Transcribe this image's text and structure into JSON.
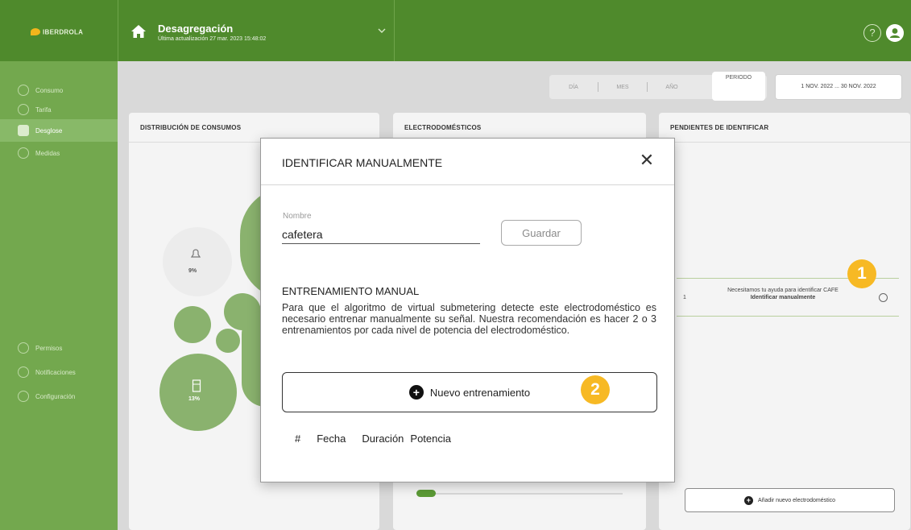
{
  "header": {
    "logo_text": "IBERDROLA",
    "title": "Desagregación",
    "subtitle": "Última actualización 27 mar. 2023 15:48:02",
    "help_label": "?"
  },
  "sidebar": {
    "items": [
      {
        "label": "Consumo"
      },
      {
        "label": "Tarifa"
      },
      {
        "label": "Desglose"
      },
      {
        "label": "Medidas"
      },
      {
        "label": "Permisos"
      },
      {
        "label": "Notificaciones"
      },
      {
        "label": "Configuración"
      }
    ]
  },
  "period": {
    "options": [
      "DÍA",
      "MES",
      "AÑO"
    ],
    "active": "PERIODO",
    "date_range": "1 NOV. 2022 ... 30 NOV. 2022"
  },
  "cards": {
    "distribution_title": "DISTRIBUCIÓN DE CONSUMOS",
    "appliances_title": "ELECTRODOMÉSTICOS",
    "pending_title": "PENDIENTES DE IDENTIFICAR"
  },
  "bubbles": {
    "percent_a": "9%",
    "percent_b": "13%"
  },
  "pending": {
    "number": "1",
    "text": "Necesitamos tu ayuda para identificar CAFE",
    "link": "Identificar manualmente"
  },
  "badges": {
    "one": "1",
    "two": "2"
  },
  "add_device_label": "Añadir nuevo electrodoméstico",
  "modal": {
    "title": "IDENTIFICAR MANUALMENTE",
    "close": "✕",
    "field_label": "Nombre",
    "field_value": "cafetera",
    "save_label": "Guardar",
    "section_title": "ENTRENAMIENTO MANUAL",
    "section_body": "Para que el algoritmo de virtual submetering detecte este electrodoméstico es necesario entrenar manualmente su señal. Nuestra recomendación es hacer 2 o 3 entrenamientos por cada nivel de potencia del electrodoméstico.",
    "new_training_label": "Nuevo entrenamiento",
    "table_headers": [
      "#",
      "Fecha",
      "Duración",
      "Potencia"
    ]
  }
}
